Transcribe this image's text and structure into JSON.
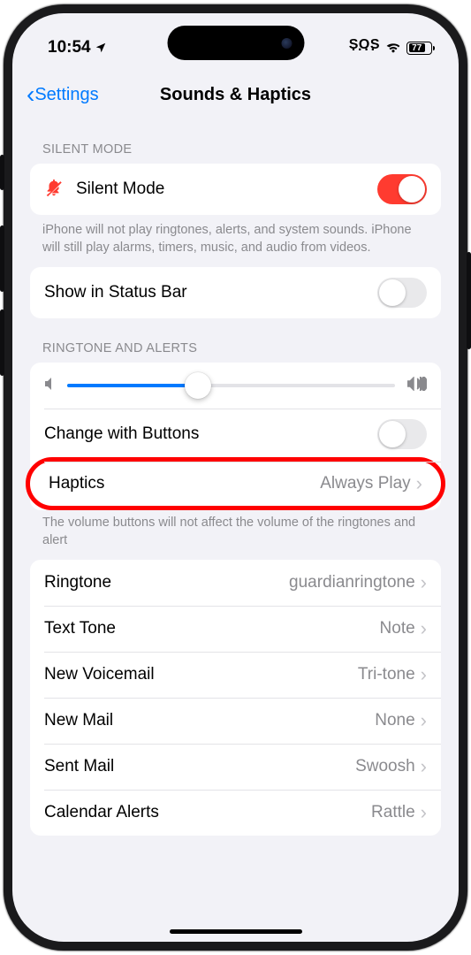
{
  "status": {
    "time": "10:54",
    "sos": "SOS",
    "battery": "77"
  },
  "nav": {
    "back": "Settings",
    "title": "Sounds & Haptics"
  },
  "silent": {
    "header": "SILENT MODE",
    "label": "Silent Mode",
    "on": true,
    "footer": "iPhone will not play ringtones, alerts, and system sounds. iPhone will still play alarms, timers, music, and audio from videos."
  },
  "statusbar_row": {
    "label": "Show in Status Bar",
    "on": false
  },
  "ringtone_alerts": {
    "header": "RINGTONE AND ALERTS",
    "slider_percent": 40,
    "change_buttons": {
      "label": "Change with Buttons",
      "on": false
    },
    "haptics": {
      "label": "Haptics",
      "value": "Always Play"
    },
    "footer": "The volume buttons will not affect the volume of the ringtones and alert"
  },
  "sounds": [
    {
      "label": "Ringtone",
      "value": "guardianringtone"
    },
    {
      "label": "Text Tone",
      "value": "Note"
    },
    {
      "label": "New Voicemail",
      "value": "Tri-tone"
    },
    {
      "label": "New Mail",
      "value": "None"
    },
    {
      "label": "Sent Mail",
      "value": "Swoosh"
    },
    {
      "label": "Calendar Alerts",
      "value": "Rattle"
    }
  ]
}
